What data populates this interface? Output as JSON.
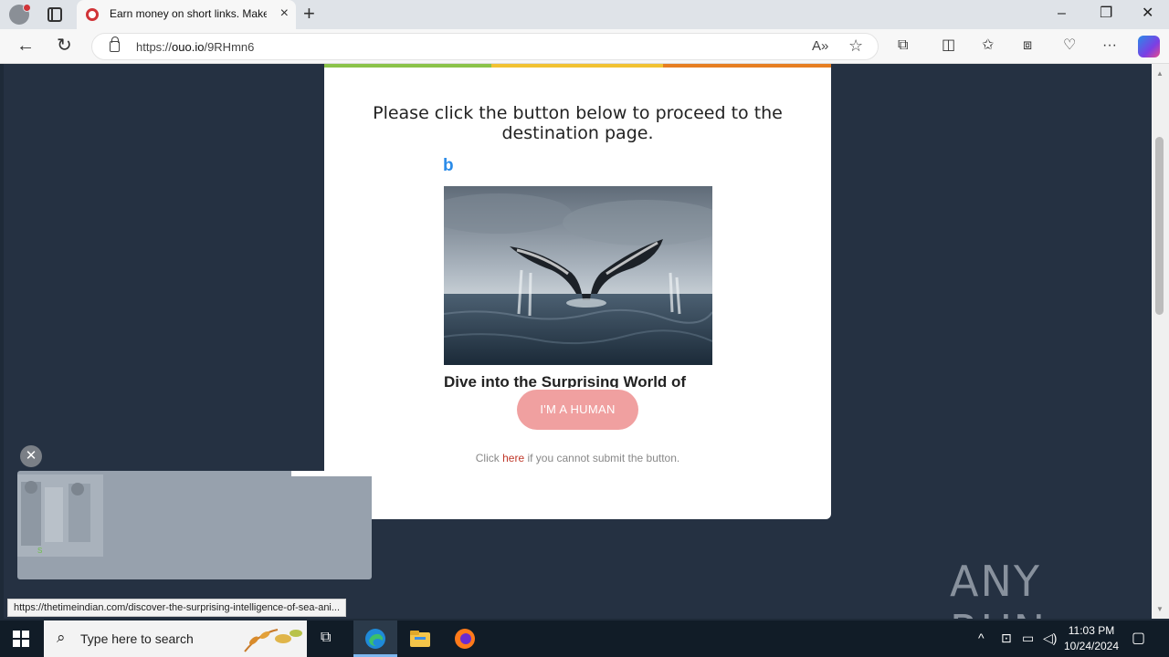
{
  "browser": {
    "tab_title": "Earn money on short links. Make",
    "url_prefix": "https://",
    "url_host": "ouo.io",
    "url_path": "/9RHmn6"
  },
  "page": {
    "heading": "Please click the button below to proceed to the destination page.",
    "ad_logo": "b",
    "ad_title": "Dive into the Surprising World of",
    "human_button": "I'M A HUMAN",
    "note_prefix": "Click ",
    "note_link": "here",
    "note_suffix": " if you cannot submit the button."
  },
  "status_bar": {
    "link_url": "https://thetimeindian.com/discover-the-surprising-intelligence-of-sea-ani..."
  },
  "watermark": "ANY RUN",
  "taskbar": {
    "search_placeholder": "Type here to search",
    "time": "11:03 PM",
    "date": "10/24/2024"
  },
  "colors": {
    "page_background": "#253142",
    "button": "#f0a0a0",
    "stripe_green": "#8bc34a",
    "stripe_yellow": "#f1c232",
    "stripe_orange": "#e67e22"
  }
}
